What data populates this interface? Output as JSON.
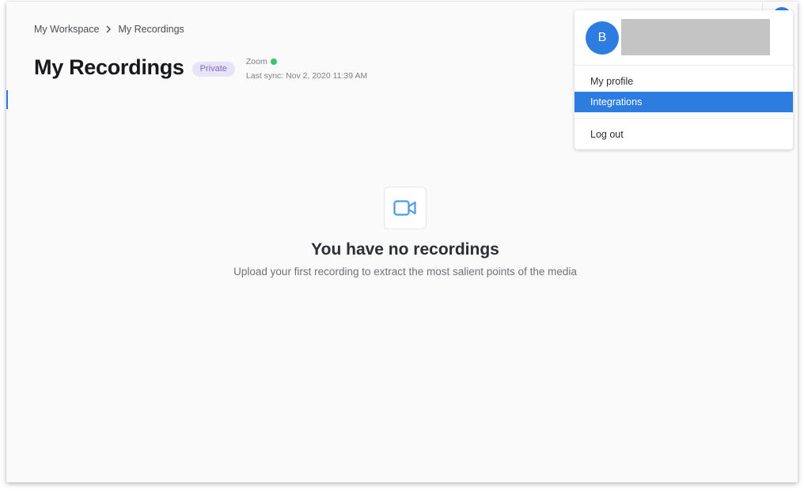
{
  "breadcrumb": {
    "items": [
      "My Workspace",
      "My Recordings"
    ]
  },
  "header": {
    "title": "My Recordings",
    "badge": "Private",
    "provider": "Zoom",
    "last_sync": "Last sync: Nov 2, 2020 11:39 AM",
    "provider_status_color": "#3cc46b"
  },
  "empty_state": {
    "icon": "video-camera-icon",
    "title": "You have no recordings",
    "subtitle": "Upload your first recording to extract the most salient points of the media"
  },
  "user_menu": {
    "avatar_initial": "B",
    "items": [
      {
        "label": "My profile",
        "active": false
      },
      {
        "label": "Integrations",
        "active": true
      },
      {
        "label": "Log out",
        "active": false
      }
    ]
  },
  "colors": {
    "accent": "#2d7de0",
    "badge_bg": "#e8e4f7",
    "badge_text": "#7f6ac8"
  }
}
